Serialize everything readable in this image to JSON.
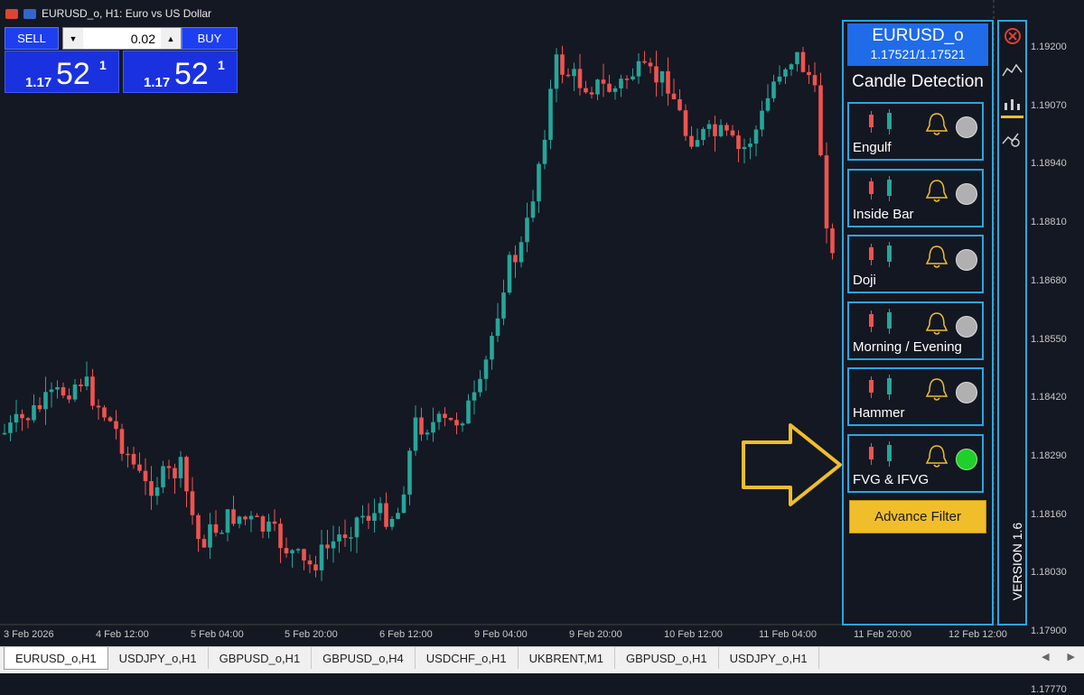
{
  "window": {
    "title": "EURUSD_o, H1:  Euro vs US Dollar"
  },
  "trade": {
    "sell_label": "SELL",
    "buy_label": "BUY",
    "lot": "0.02",
    "sell_price_prefix": "1.17",
    "sell_price_big": "52",
    "sell_price_sup": "1",
    "buy_price_prefix": "1.17",
    "buy_price_big": "52",
    "buy_price_sup": "1"
  },
  "y_axis": [
    "1.19200",
    "1.19070",
    "1.18940",
    "1.18810",
    "1.18680",
    "1.18550",
    "1.18420",
    "1.18290",
    "1.18160",
    "1.18030",
    "1.17900",
    "1.17770"
  ],
  "x_axis": [
    "3 Feb 2026",
    "4 Feb 12:00",
    "5 Feb 04:00",
    "5 Feb 20:00",
    "6 Feb 12:00",
    "9 Feb 04:00",
    "9 Feb 20:00",
    "10 Feb 12:00",
    "11 Feb 04:00",
    "11 Feb 20:00",
    "12 Feb 12:00"
  ],
  "panel": {
    "symbol": "EURUSD_o",
    "bidask": "1.17521/1.17521",
    "title": "Candle Detection",
    "patterns": [
      {
        "label": "Engulf",
        "enabled": false
      },
      {
        "label": "Inside Bar",
        "enabled": false
      },
      {
        "label": "Doji",
        "enabled": false
      },
      {
        "label": "Morning / Evening",
        "enabled": false
      },
      {
        "label": "Hammer",
        "enabled": false
      },
      {
        "label": "FVG & IFVG",
        "enabled": true
      }
    ],
    "advance_filter_label": "Advance Filter",
    "version": "VERSION 1.6"
  },
  "tabs": [
    "EURUSD_o,H1",
    "USDJPY_o,H1",
    "GBPUSD_o,H1",
    "GBPUSD_o,H4",
    "USDCHF_o,H1",
    "UKBRENT,M1",
    "GBPUSD_o,H1",
    "USDJPY_o,H1"
  ],
  "colors": {
    "bull": "#26a69a",
    "bear": "#ef5350",
    "panel_border": "#2ba6e0",
    "arrow": "#f0be2a"
  }
}
